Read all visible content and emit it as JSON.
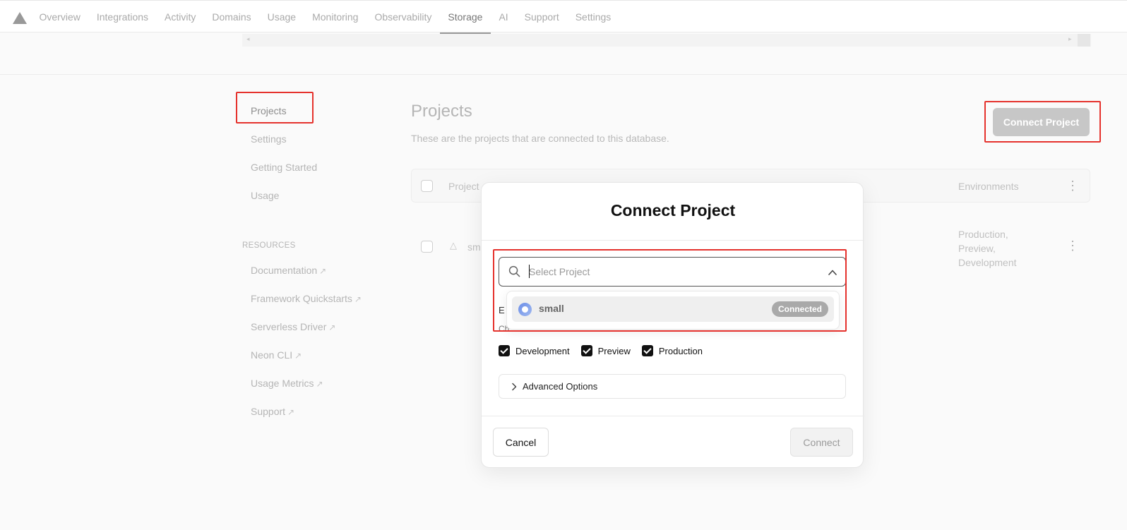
{
  "nav": {
    "tabs": [
      "Overview",
      "Integrations",
      "Activity",
      "Domains",
      "Usage",
      "Monitoring",
      "Observability",
      "Storage",
      "AI",
      "Support",
      "Settings"
    ],
    "active_tab": "Storage"
  },
  "sidebar": {
    "items": [
      "Projects",
      "Settings",
      "Getting Started",
      "Usage"
    ],
    "resources_heading": "RESOURCES",
    "resources": [
      "Documentation",
      "Framework Quickstarts",
      "Serverless Driver",
      "Neon CLI",
      "Usage Metrics",
      "Support"
    ]
  },
  "main": {
    "title": "Projects",
    "subtitle": "These are the projects that are connected to this database.",
    "connect_button": "Connect Project",
    "table": {
      "col_project": "Project",
      "col_environments": "Environments",
      "row_name_partial": "sm",
      "row_environments": [
        "Production,",
        "Preview,",
        "Development"
      ]
    }
  },
  "modal": {
    "title": "Connect Project",
    "select_placeholder": "Select Project",
    "obscured_label": "E",
    "obscured_desc": "Ch",
    "dropdown": {
      "project_name": "small",
      "badge": "Connected"
    },
    "environments": [
      "Development",
      "Preview",
      "Production"
    ],
    "advanced_label": "Advanced Options",
    "cancel_label": "Cancel",
    "connect_label": "Connect"
  },
  "colors": {
    "annotation_red": "#e5322d",
    "checkbox_fill": "#111111",
    "badge_bg": "#a9a9a9"
  }
}
